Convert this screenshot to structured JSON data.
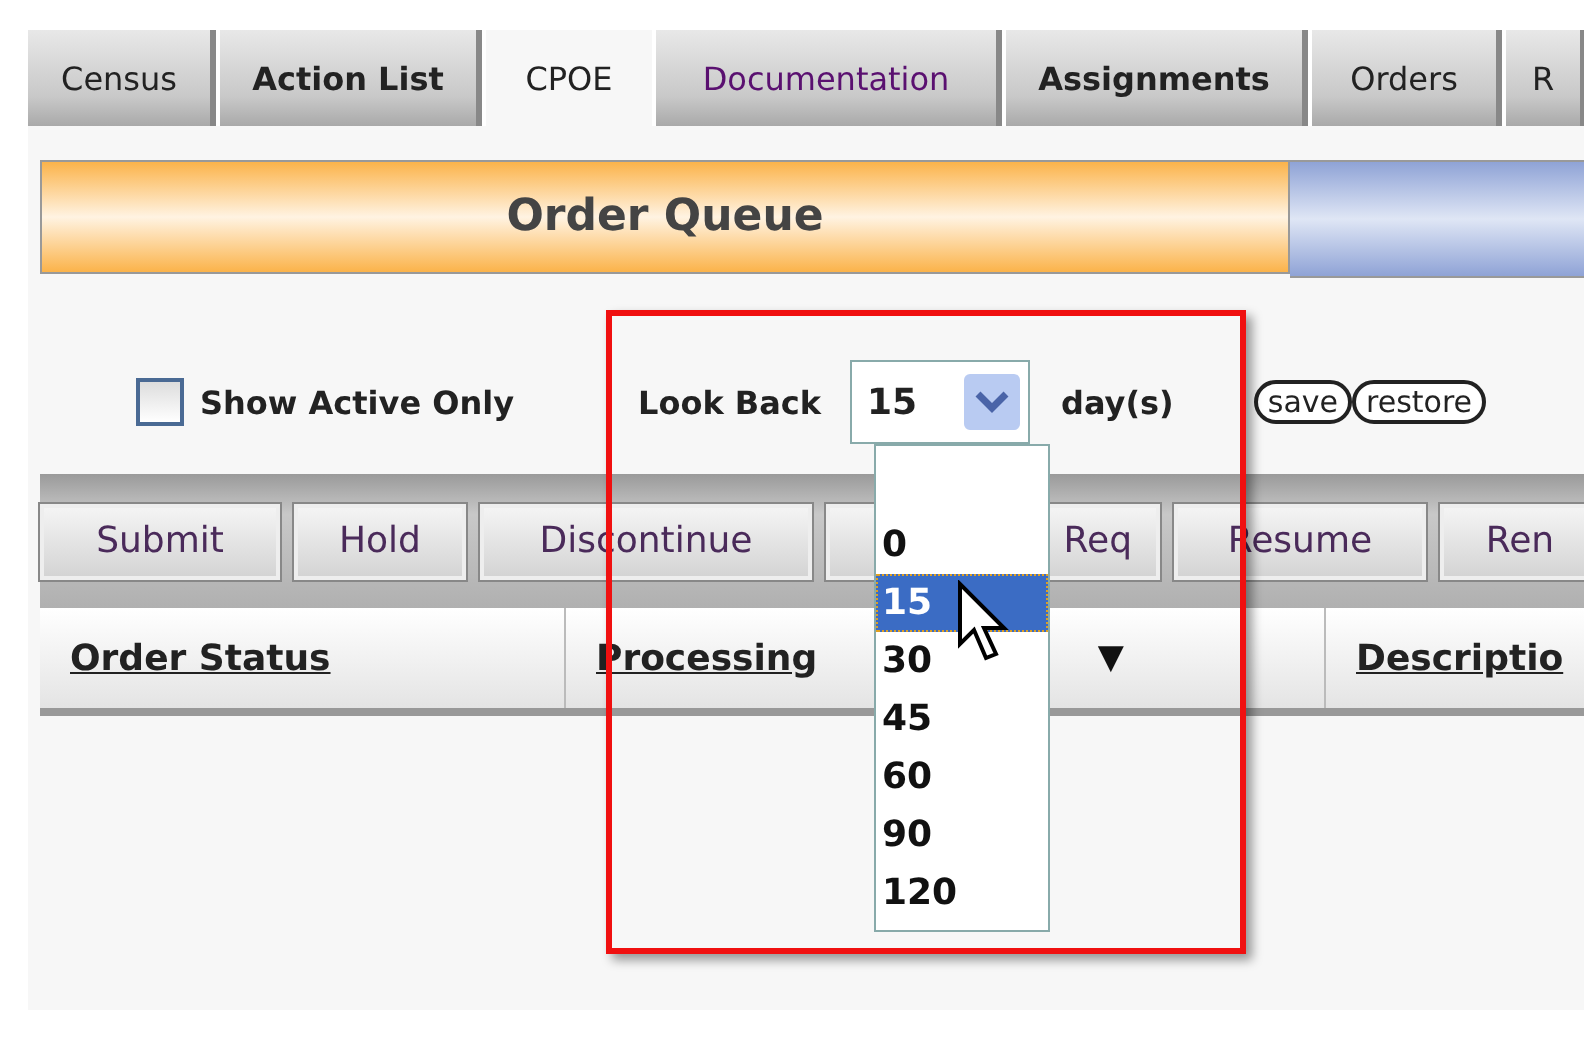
{
  "tabs": [
    {
      "label": "Census",
      "selected": false,
      "bold": false,
      "visited": false
    },
    {
      "label": "Action List",
      "selected": false,
      "bold": true,
      "visited": false
    },
    {
      "label": "CPOE",
      "selected": true,
      "bold": false,
      "visited": false
    },
    {
      "label": "Documentation",
      "selected": false,
      "bold": false,
      "visited": true
    },
    {
      "label": "Assignments",
      "selected": false,
      "bold": true,
      "visited": false
    },
    {
      "label": "Orders",
      "selected": false,
      "bold": false,
      "visited": false
    },
    {
      "label": "R",
      "selected": false,
      "bold": false,
      "visited": false
    }
  ],
  "header": {
    "title": "Order Queue"
  },
  "filters": {
    "show_active_only": {
      "label": "Show Active Only",
      "checked": false
    },
    "look_back": {
      "label": "Look Back",
      "value": "15",
      "unit": "day(s)",
      "expanded": true,
      "options": [
        {
          "label": "0",
          "selected": false
        },
        {
          "label": "15",
          "selected": true
        },
        {
          "label": "30",
          "selected": false
        },
        {
          "label": "45",
          "selected": false
        },
        {
          "label": "60",
          "selected": false
        },
        {
          "label": "90",
          "selected": false
        },
        {
          "label": "120",
          "selected": false
        }
      ]
    },
    "actions": [
      "save",
      "restore"
    ]
  },
  "toolbar": {
    "buttons": [
      "Submit",
      "Hold",
      "Discontinue",
      "Req",
      "Resume",
      "Ren"
    ]
  },
  "table": {
    "columns": [
      {
        "label": "Order Status"
      },
      {
        "label": "Processing",
        "sort": "▼"
      },
      {
        "label": "Descriptio"
      }
    ]
  }
}
